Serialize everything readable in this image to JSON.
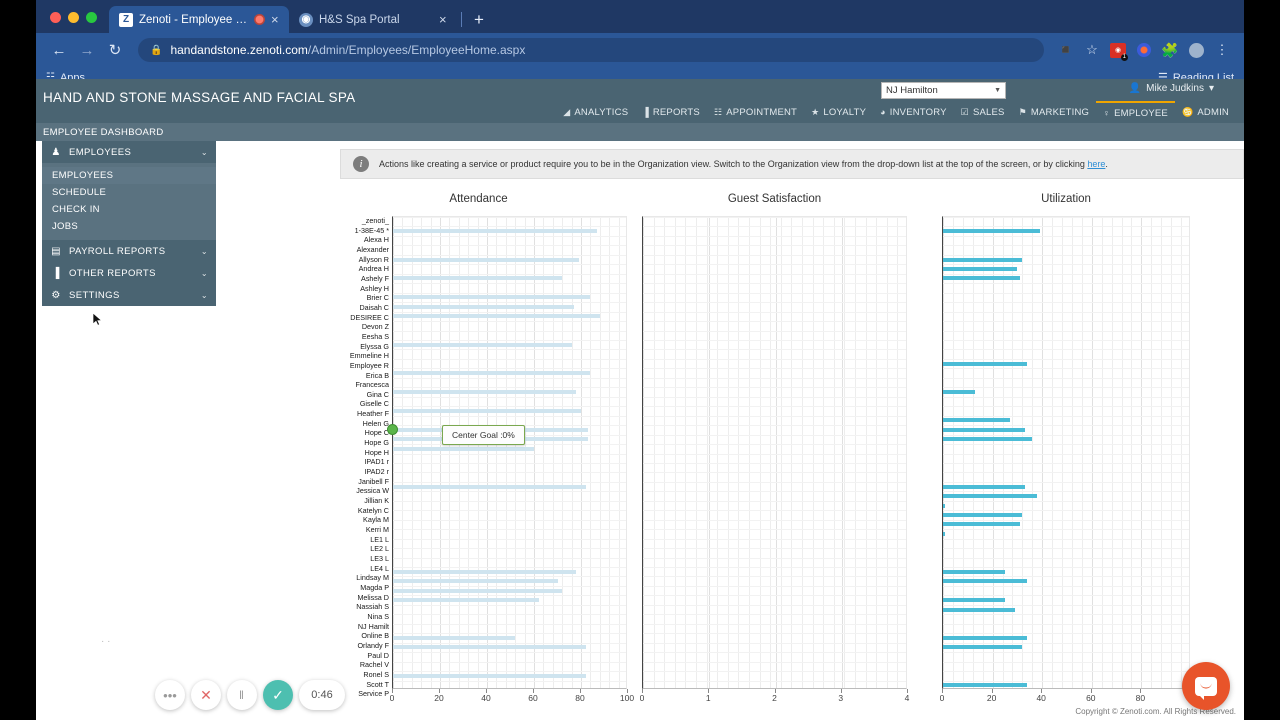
{
  "browser": {
    "tabs": [
      {
        "title": "Zenoti - Employee Home",
        "favicon": "Z",
        "active": true,
        "recording": true,
        "close": "×"
      },
      {
        "title": "H&S Spa Portal",
        "favicon": "◉",
        "active": false,
        "recording": false,
        "close": "×"
      }
    ],
    "new_tab_label": "+",
    "toolbar": {
      "back": "←",
      "forward": "→",
      "reload": "↻",
      "lock": "🔒",
      "url_host": "handandstone.zenoti.com",
      "url_path": "/Admin/Employees/EmployeeHome.aspx",
      "camera_icon": "■",
      "star_icon": "☆",
      "ext_badge": "1",
      "menu_icon": "⋮"
    },
    "bookmarks": {
      "apps_label": "Apps",
      "reading_list_label": "Reading List"
    }
  },
  "app": {
    "brand": "HAND AND STONE MASSAGE AND FACIAL SPA",
    "org_select": {
      "value": "NJ Hamilton",
      "caret": "▼"
    },
    "user_menu": {
      "name": "Mike Judkins",
      "caret": "▾",
      "icon": "&#128100;"
    },
    "nav": [
      {
        "label": "ANALYTICS",
        "icon": "◢",
        "active": false
      },
      {
        "label": "REPORTS",
        "icon": "▐",
        "active": false
      },
      {
        "label": "APPOINTMENT",
        "icon": "☷",
        "active": false
      },
      {
        "label": "LOYALTY",
        "icon": "★",
        "active": false
      },
      {
        "label": "INVENTORY",
        "icon": "◕",
        "active": false
      },
      {
        "label": "SALES",
        "icon": "☑",
        "active": false
      },
      {
        "label": "MARKETING",
        "icon": "⚑",
        "active": false
      },
      {
        "label": "EMPLOYEE",
        "icon": "♀",
        "active": true
      },
      {
        "label": "ADMIN",
        "icon": "♋",
        "active": false
      }
    ],
    "sub_header": "EMPLOYEE DASHBOARD"
  },
  "sidebar": {
    "groups": [
      {
        "label": "EMPLOYEES",
        "icon": "♟",
        "chevron": "⌄",
        "expanded": true
      },
      {
        "label": "PAYROLL REPORTS",
        "icon": "▤",
        "chevron": "⌄",
        "expanded": false
      },
      {
        "label": "OTHER REPORTS",
        "icon": "▐",
        "chevron": "⌄",
        "expanded": false
      },
      {
        "label": "SETTINGS",
        "icon": "⚙",
        "chevron": "⌄",
        "expanded": false
      }
    ],
    "sub_items": [
      {
        "label": "EMPLOYEES",
        "selected": true
      },
      {
        "label": "SCHEDULE",
        "selected": false
      },
      {
        "label": "CHECK IN",
        "selected": false
      },
      {
        "label": "JOBS",
        "selected": false
      }
    ]
  },
  "info_bar": {
    "icon": "i",
    "text": "Actions like creating a service or product require you to be in the Organization view. Switch to the Organization view from the drop-down list at the top of the screen, or by clicking ",
    "link": "here",
    "text_end": "."
  },
  "tooltip": {
    "text": "Center Goal :0%"
  },
  "copyright": "Copyright © Zenoti.com. All Rights Reserved.",
  "recorder": {
    "more": "•••",
    "stop": "✕",
    "pause": "‖",
    "confirm": "✓",
    "time": "0:46",
    "dots": "· ·"
  },
  "chat": {
    "label": "chat-bubble"
  },
  "chart_data": [
    {
      "type": "bar",
      "title": "Attendance",
      "orientation": "horizontal",
      "xlabel": "",
      "ylabel": "",
      "xlim": [
        0,
        100
      ],
      "xticks": [
        0,
        20,
        40,
        60,
        80,
        100
      ],
      "grid": true,
      "bar_color": "#cfe4ef",
      "categories": [
        "_zenoti_",
        "1-38E-45 *",
        "Alexa H",
        "Alexander",
        "Allyson R",
        "Andrea H",
        "Ashely F",
        "Ashley H",
        "Brier C",
        "Daisah C",
        "DESIREE C",
        "Devon Z",
        "Eesha S",
        "Elyssa G",
        "Emmeline H",
        "Employee R",
        "Erica B",
        "Francesca",
        "Gina C",
        "Giselle C",
        "Heather F",
        "Helen G",
        "Hope C",
        "Hope G",
        "Hope H",
        "IPAD1 r",
        "IPAD2 r",
        "Janibell F",
        "Jessica W",
        "Jillian K",
        "Katelyn C",
        "Kayla M",
        "Kerri M",
        "LE1 L",
        "LE2 L",
        "LE3 L",
        "LE4 L",
        "Lindsay M",
        "Magda P",
        "Melissa D",
        "Nassiah S",
        "Nina S",
        "NJ Hamilt",
        "Online B",
        "Orlandy F",
        "Paul D",
        "Rachel V",
        "Ronel S",
        "Scott T",
        "Service P"
      ],
      "values": [
        0,
        87,
        0,
        0,
        79,
        0,
        72,
        0,
        84,
        77,
        88,
        0,
        0,
        76,
        0,
        0,
        84,
        0,
        78,
        0,
        80,
        0,
        83,
        83,
        60,
        0,
        0,
        0,
        82,
        0,
        0,
        0,
        0,
        0,
        0,
        0,
        0,
        78,
        70,
        72,
        62,
        0,
        0,
        0,
        52,
        82,
        0,
        0,
        82,
        0
      ]
    },
    {
      "type": "bar",
      "title": "Guest Satisfaction",
      "orientation": "horizontal",
      "xlabel": "",
      "ylabel": "",
      "xlim": [
        0,
        4
      ],
      "xticks": [
        0,
        1,
        2,
        3,
        4
      ],
      "grid": true,
      "bar_color": "#cfe4ef",
      "categories": [
        "_zenoti_",
        "1-38E-45 *",
        "Alexa H",
        "Alexander",
        "Allyson R",
        "Andrea H",
        "Ashely F",
        "Ashley H",
        "Brier C",
        "Daisah C",
        "DESIREE C",
        "Devon Z",
        "Eesha S",
        "Elyssa G",
        "Emmeline H",
        "Employee R",
        "Erica B",
        "Francesca",
        "Gina C",
        "Giselle C",
        "Heather F",
        "Helen G",
        "Hope C",
        "Hope G",
        "Hope H",
        "IPAD1 r",
        "IPAD2 r",
        "Janibell F",
        "Jessica W",
        "Jillian K",
        "Katelyn C",
        "Kayla M",
        "Kerri M",
        "LE1 L",
        "LE2 L",
        "LE3 L",
        "LE4 L",
        "Lindsay M",
        "Magda P",
        "Melissa D",
        "Nassiah S",
        "Nina S",
        "NJ Hamilt",
        "Online B",
        "Orlandy F",
        "Paul D",
        "Rachel V",
        "Ronel S",
        "Scott T",
        "Service P"
      ],
      "values": [
        0,
        0,
        0,
        0,
        0,
        0,
        0,
        0,
        0,
        0,
        0,
        0,
        0,
        0,
        0,
        0,
        0,
        0,
        0,
        0,
        0,
        0,
        0,
        0,
        0,
        0,
        0,
        0,
        0,
        0,
        0,
        0,
        0,
        0,
        0,
        0,
        0,
        0,
        0,
        0,
        0,
        0,
        0,
        0,
        0,
        0,
        0,
        0,
        0,
        0
      ]
    },
    {
      "type": "bar",
      "title": "Utilization",
      "orientation": "horizontal",
      "xlabel": "",
      "ylabel": "",
      "xlim": [
        0,
        100
      ],
      "xticks": [
        0,
        20,
        40,
        60,
        80
      ],
      "grid": true,
      "bar_color": "#4bbcd6",
      "categories": [
        "_zenoti_",
        "1-38E-45 *",
        "Alexa H",
        "Alexander",
        "Allyson R",
        "Andrea H",
        "Ashely F",
        "Ashley H",
        "Brier C",
        "Daisah C",
        "DESIREE C",
        "Devon Z",
        "Eesha S",
        "Elyssa G",
        "Emmeline H",
        "Employee R",
        "Erica B",
        "Francesca",
        "Gina C",
        "Giselle C",
        "Heather F",
        "Helen G",
        "Hope C",
        "Hope G",
        "Hope H",
        "IPAD1 r",
        "IPAD2 r",
        "Janibell F",
        "Jessica W",
        "Jillian K",
        "Katelyn C",
        "Kayla M",
        "Kerri M",
        "LE1 L",
        "LE2 L",
        "LE3 L",
        "LE4 L",
        "Lindsay M",
        "Magda P",
        "Melissa D",
        "Nassiah S",
        "Nina S",
        "NJ Hamilt",
        "Online B",
        "Orlandy F",
        "Paul D",
        "Rachel V",
        "Ronel S",
        "Scott T",
        "Service P"
      ],
      "values": [
        0,
        39,
        0,
        0,
        32,
        30,
        31,
        0,
        0,
        0,
        0,
        0,
        0,
        0,
        0,
        34,
        0,
        0,
        13,
        0,
        0,
        27,
        33,
        36,
        0,
        0,
        0,
        0,
        33,
        38,
        1,
        32,
        31,
        1,
        0,
        0,
        0,
        25,
        34,
        0,
        25,
        29,
        0,
        0,
        34,
        32,
        0,
        0,
        0,
        34
      ]
    }
  ]
}
